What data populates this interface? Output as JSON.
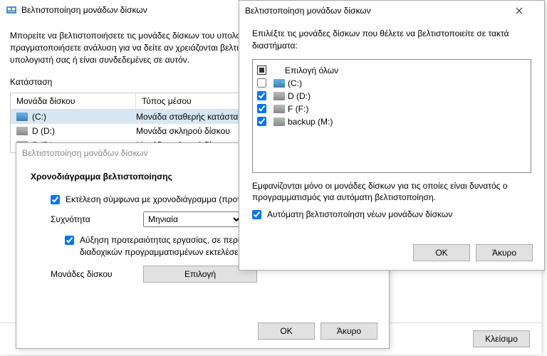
{
  "main": {
    "title": "Βελτιστοποίηση μονάδων δίσκων",
    "description": "Μπορείτε να βελτιστοποιήσετε τις μονάδες δίσκων του υπολογιστή σας για να τον βοηθήσετε να λειτουργεί πιο αποτελεσματικά ή να πραγματοποιήσετε ανάλυση για να δείτε αν χρειάζονται βελτιστοποίηση. Εμφανίζονται μόνο οι μονάδες δίσκου που υπάρχουν στον υπολογιστή σας ή είναι συνδεδεμένες σε αυτόν.",
    "status_label": "Κατάσταση",
    "columns": {
      "drive": "Μονάδα δίσκου",
      "media": "Τύπος μέσου"
    },
    "rows": [
      {
        "name": "(C:)",
        "ssd": true,
        "media": "Μονάδα σταθερής κατάστασης"
      },
      {
        "name": "D (D:)",
        "ssd": false,
        "media": "Μονάδα σκληρού δίσκου"
      },
      {
        "name": "F (F:)",
        "ssd": false,
        "media": "Μονάδα σκληρού δίσκου"
      }
    ],
    "close_button": "Κλείσιμο"
  },
  "sched": {
    "title": "Βελτιστοποίηση μονάδων δίσκων",
    "heading": "Χρονοδιάγραμμα βελτιστοποίησης",
    "run_on_schedule": "Εκτέλεση σύμφωνα με χρονοδιάγραμμα (προτείνεται)",
    "frequency_label": "Συχνότητα",
    "frequency_value": "Μηνιαία",
    "priority": "Αύξηση προτεραιότητας εργασίας, σε περίπτωση που παραλειφθούν τρεις διαδοχικών προγραμματισμένων εκτελέσεων",
    "drives_label": "Μονάδες δίσκου",
    "choose_button": "Επιλογή",
    "ok": "OK",
    "cancel": "Άκυρο"
  },
  "drives": {
    "title": "Βελτιστοποίηση μονάδων δίσκων",
    "description": "Επιλέξτε τις μονάδες δίσκων που θέλετε να βελτιστοποιείτε σε τακτά διαστήματα:",
    "select_all": "Επιλογή όλων",
    "items": [
      {
        "name": "(C:)",
        "checked": false,
        "ssd": true
      },
      {
        "name": "D (D:)",
        "checked": true,
        "ssd": false
      },
      {
        "name": "F (F:)",
        "checked": true,
        "ssd": false
      },
      {
        "name": "backup (M:)",
        "checked": true,
        "ssd": false
      }
    ],
    "note": "Εμφανίζονται μόνο οι μονάδες δίσκων για τις οποίες είναι δυνατός ο προγραμματισμός για αυτόματη βελτιστοποίηση.",
    "auto_new": "Αυτόματη βελτιστοποίηση νέων μονάδων δίσκων",
    "ok": "OK",
    "cancel": "Άκυρο"
  }
}
